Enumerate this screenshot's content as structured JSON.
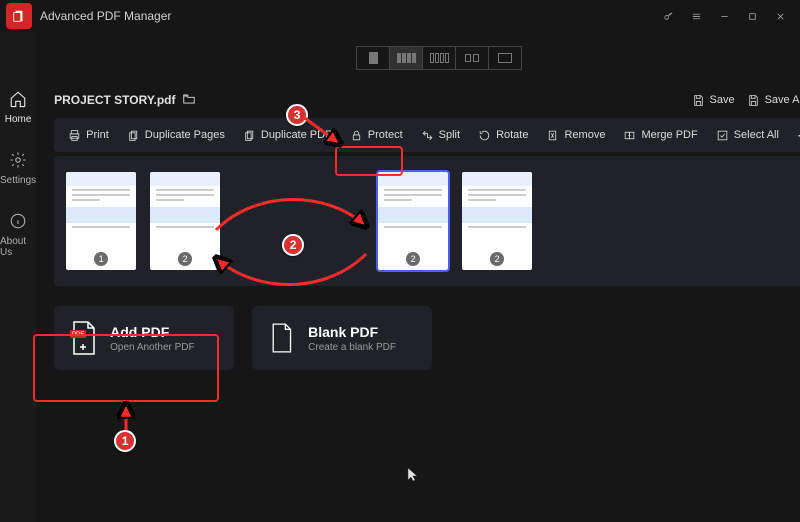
{
  "app": {
    "title": "Advanced PDF Manager"
  },
  "sidebar": {
    "home": "Home",
    "settings": "Settings",
    "about": "About Us"
  },
  "file": {
    "name": "PROJECT STORY.pdf"
  },
  "titleActions": {
    "save": "Save",
    "saveAs": "Save As"
  },
  "toolbar": {
    "print": "Print",
    "duplicatePages": "Duplicate Pages",
    "duplicatePdf": "Duplicate PDF",
    "protect": "Protect",
    "split": "Split",
    "rotate": "Rotate",
    "remove": "Remove",
    "mergePdf": "Merge PDF",
    "selectAll": "Select All"
  },
  "thumbs": [
    {
      "num": "1"
    },
    {
      "num": "2"
    },
    {
      "num": "2",
      "selected": true
    },
    {
      "num": "2"
    }
  ],
  "cards": {
    "addPdf": {
      "title": "Add PDF",
      "sub": "Open Another PDF",
      "badge": "PDF"
    },
    "blankPdf": {
      "title": "Blank PDF",
      "sub": "Create a blank PDF"
    }
  },
  "annotations": {
    "n1": "1",
    "n2": "2",
    "n3": "3"
  }
}
